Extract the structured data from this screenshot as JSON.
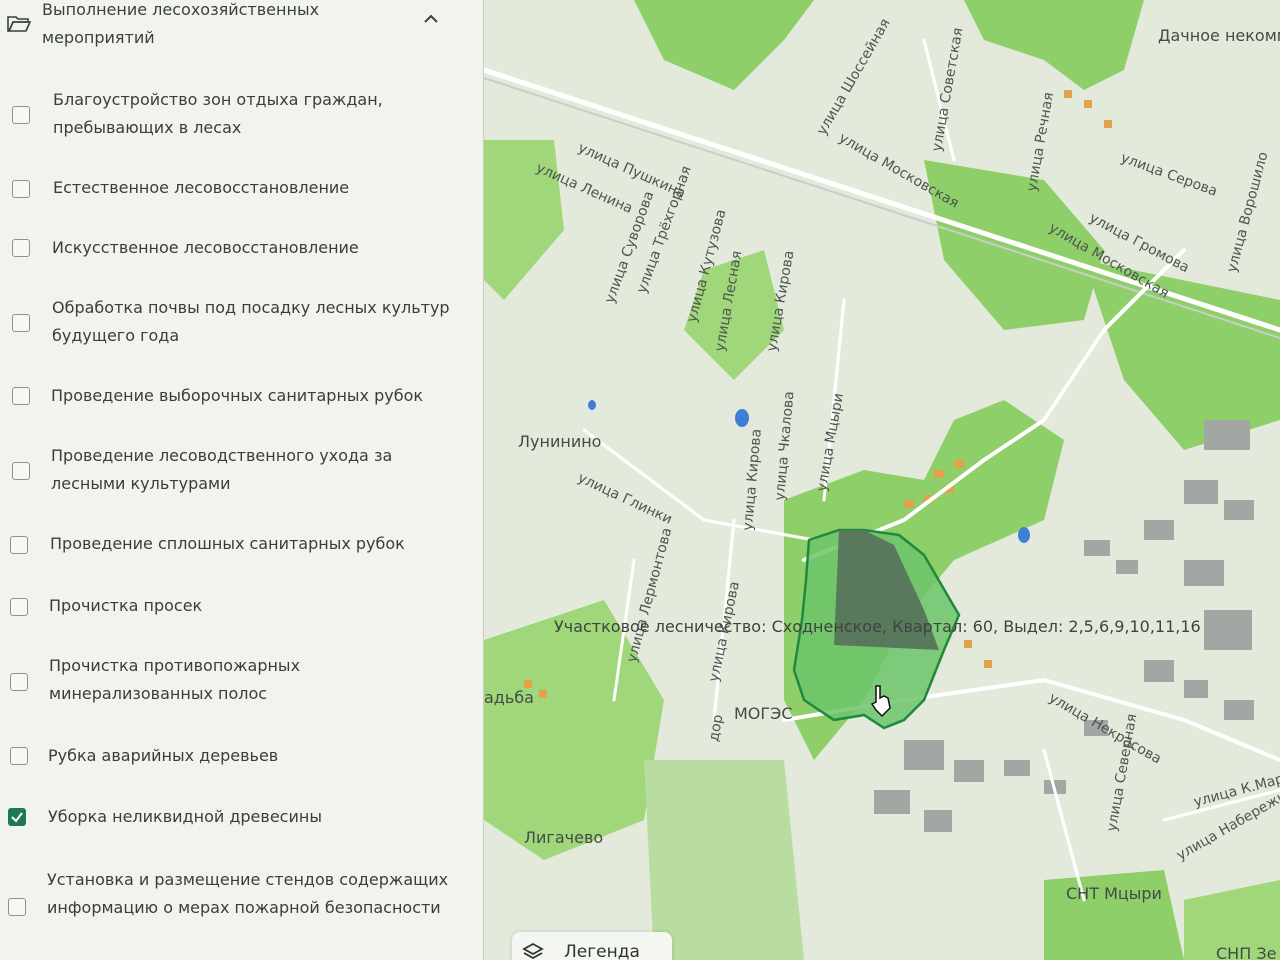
{
  "sidebar": {
    "section_title": "Выполнение лесохозяйственных мероприятий",
    "items": [
      {
        "label": "Благоустройство зон отдыха граждан, пребывающих в лесах",
        "checked": false
      },
      {
        "label": "Естественное лесовосстановление",
        "checked": false
      },
      {
        "label": "Искусственное лесовосстановление",
        "checked": false
      },
      {
        "label": "Обработка почвы под посадку лесных культур будущего года",
        "checked": false
      },
      {
        "label": "Проведение выборочных санитарных рубок",
        "checked": false
      },
      {
        "label": "Проведение лесоводственного ухода за лесными культурами",
        "checked": false
      },
      {
        "label": "Проведение сплошных санитарных рубок",
        "checked": false
      },
      {
        "label": "Прочистка просек",
        "checked": false
      },
      {
        "label": "Прочистка противопожарных минерализованных полос",
        "checked": false
      },
      {
        "label": "Рубка аварийных деревьев",
        "checked": false
      },
      {
        "label": "Уборка неликвидной древесины",
        "checked": true
      },
      {
        "label": "Установка и размещение стендов содержащих информацию о мерах пожарной безопасности",
        "checked": false
      }
    ]
  },
  "map": {
    "tooltip": "Участковое лесничество: Сходненское, Квартал: 60, Выдел: 2,5,6,9,10,11,16",
    "legend_label": "Легенда",
    "colors": {
      "forest": "#8ecf6a",
      "selected_fill": "#6cc46a",
      "selected_dark": "#55705a",
      "outline": "#1f8a3e",
      "buildings": "#a3a7a3"
    },
    "streets": [
      "улица Пушкина",
      "улица Ленина",
      "улица Суворова",
      "улица Трёхгорная",
      "улица Кутузова",
      "улица Лесная",
      "улица Кирова",
      "улица Шоссейная",
      "улица Советская",
      "улица Московская",
      "улица Речная",
      "улица Серова",
      "улица Громова",
      "улица Московская",
      "улица Ворошило",
      "улица Глинки",
      "улица Кирова",
      "улица Чкалова",
      "улица Мцыри",
      "улица Лермонтова",
      "улица Кирова",
      "улица Некрасова",
      "улица Северная",
      "улица К.Мар",
      "улица Набережн",
      "дор"
    ],
    "places": [
      "Лунинино",
      "Лигачево",
      "МОГЭС",
      "СНТ Мцыри",
      "Дачное некомм",
      "СНП Зе",
      "адьба"
    ]
  }
}
